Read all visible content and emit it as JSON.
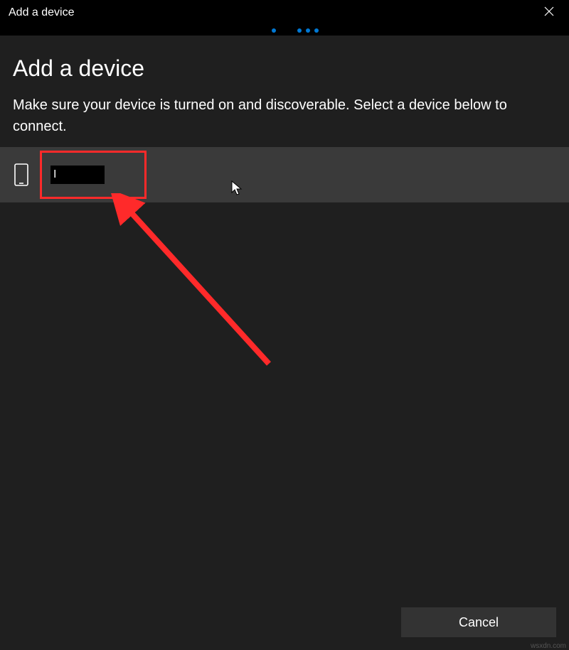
{
  "titlebar": {
    "title": "Add a device"
  },
  "heading": "Add a device",
  "subtext": "Make sure your device is turned on and discoverable. Select a device below to connect.",
  "device": {
    "name": "I"
  },
  "footer": {
    "cancel": "Cancel"
  },
  "watermark": "wsxdn.com",
  "colors": {
    "accent": "#0078d4",
    "highlight": "#ff2a2a",
    "row_bg": "#3a3a3a",
    "button_bg": "#333333"
  }
}
